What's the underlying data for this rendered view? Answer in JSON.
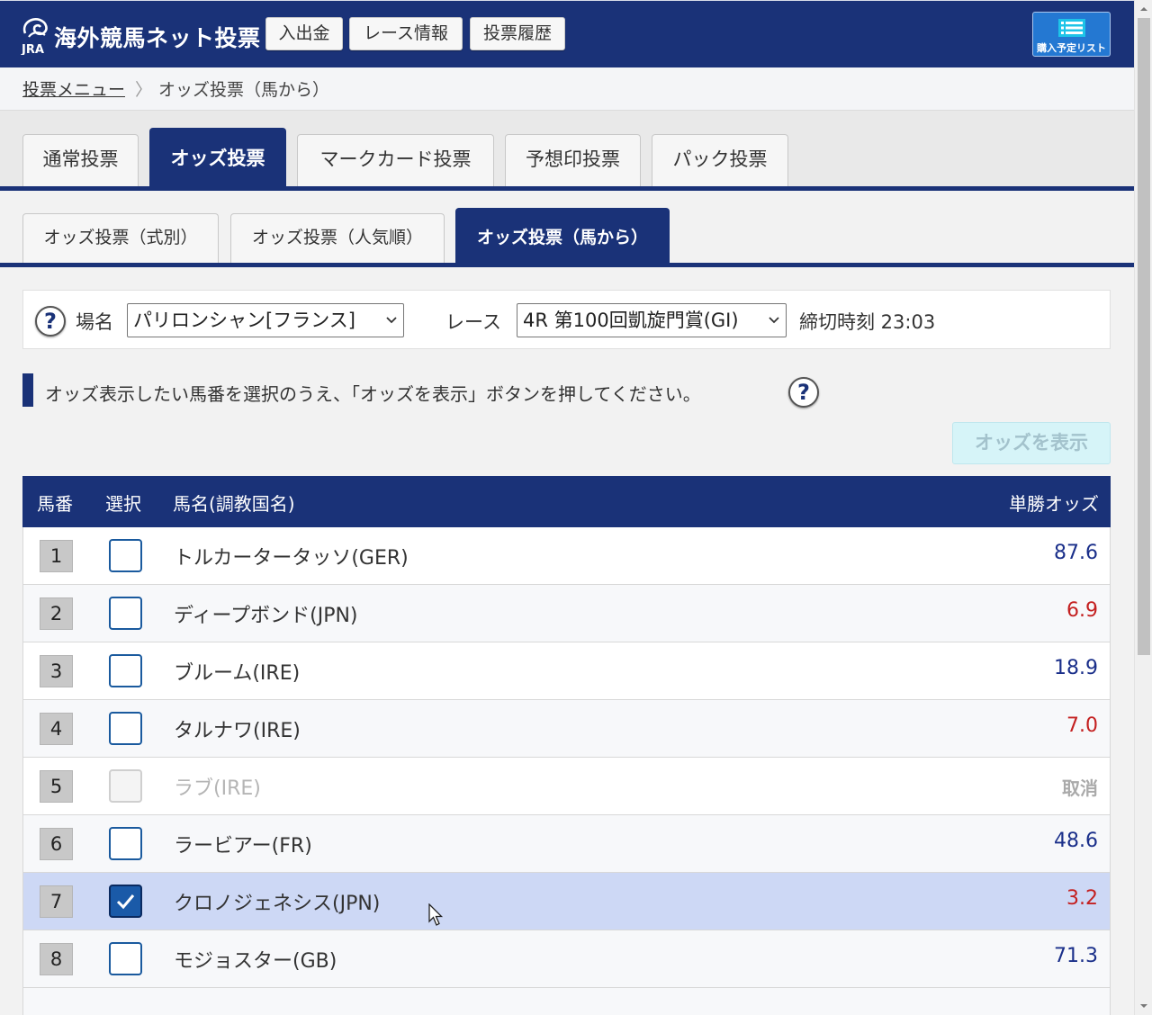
{
  "header": {
    "logo_mark": "JRA",
    "logo_text": "海外競馬ネット投票",
    "buttons": [
      "入出金",
      "レース情報",
      "投票履歴"
    ],
    "list_button_label": "購入予定リスト",
    "bg_color": "#1a3278"
  },
  "breadcrumb": {
    "link": "投票メニュー",
    "separator": "〉",
    "current": "オッズ投票（馬から）"
  },
  "main_tabs": [
    "通常投票",
    "オッズ投票",
    "マークカード投票",
    "予想印投票",
    "パック投票"
  ],
  "main_tab_active": "オッズ投票",
  "sub_tabs": [
    "オッズ投票（式別）",
    "オッズ投票（人気順）",
    "オッズ投票（馬から）"
  ],
  "sub_tab_active": "オッズ投票（馬から）",
  "selector": {
    "help": "?",
    "venue_label": "場名",
    "venue_value": "パリロンシャン[フランス]",
    "race_label": "レース",
    "race_value": "4R 第100回凱旋門賞(GI)",
    "deadline": "締切時刻 23:03"
  },
  "instruction": "オッズ表示したい馬番を選択のうえ、「オッズを表示」ボタンを押してください。",
  "odds_button": "オッズを表示",
  "table": {
    "headers": {
      "num": "馬番",
      "select": "選択",
      "name": "馬名(調教国名)",
      "odds": "単勝オッズ"
    },
    "rows": [
      {
        "num": "1",
        "name": "トルカータータッソ(GER)",
        "odds": "87.6",
        "odds_color": "blue",
        "checked": false,
        "disabled": false
      },
      {
        "num": "2",
        "name": "ディープボンド(JPN)",
        "odds": "6.9",
        "odds_color": "red",
        "checked": false,
        "disabled": false
      },
      {
        "num": "3",
        "name": "ブルーム(IRE)",
        "odds": "18.9",
        "odds_color": "blue",
        "checked": false,
        "disabled": false
      },
      {
        "num": "4",
        "name": "タルナワ(IRE)",
        "odds": "7.0",
        "odds_color": "red",
        "checked": false,
        "disabled": false
      },
      {
        "num": "5",
        "name": "ラブ(IRE)",
        "odds": "取消",
        "odds_color": "cancel",
        "checked": false,
        "disabled": true
      },
      {
        "num": "6",
        "name": "ラービアー(FR)",
        "odds": "48.6",
        "odds_color": "blue",
        "checked": false,
        "disabled": false
      },
      {
        "num": "7",
        "name": "クロノジェネシス(JPN)",
        "odds": "3.2",
        "odds_color": "red",
        "checked": true,
        "disabled": false
      },
      {
        "num": "8",
        "name": "モジョスター(GB)",
        "odds": "71.3",
        "odds_color": "blue",
        "checked": false,
        "disabled": false
      }
    ]
  }
}
